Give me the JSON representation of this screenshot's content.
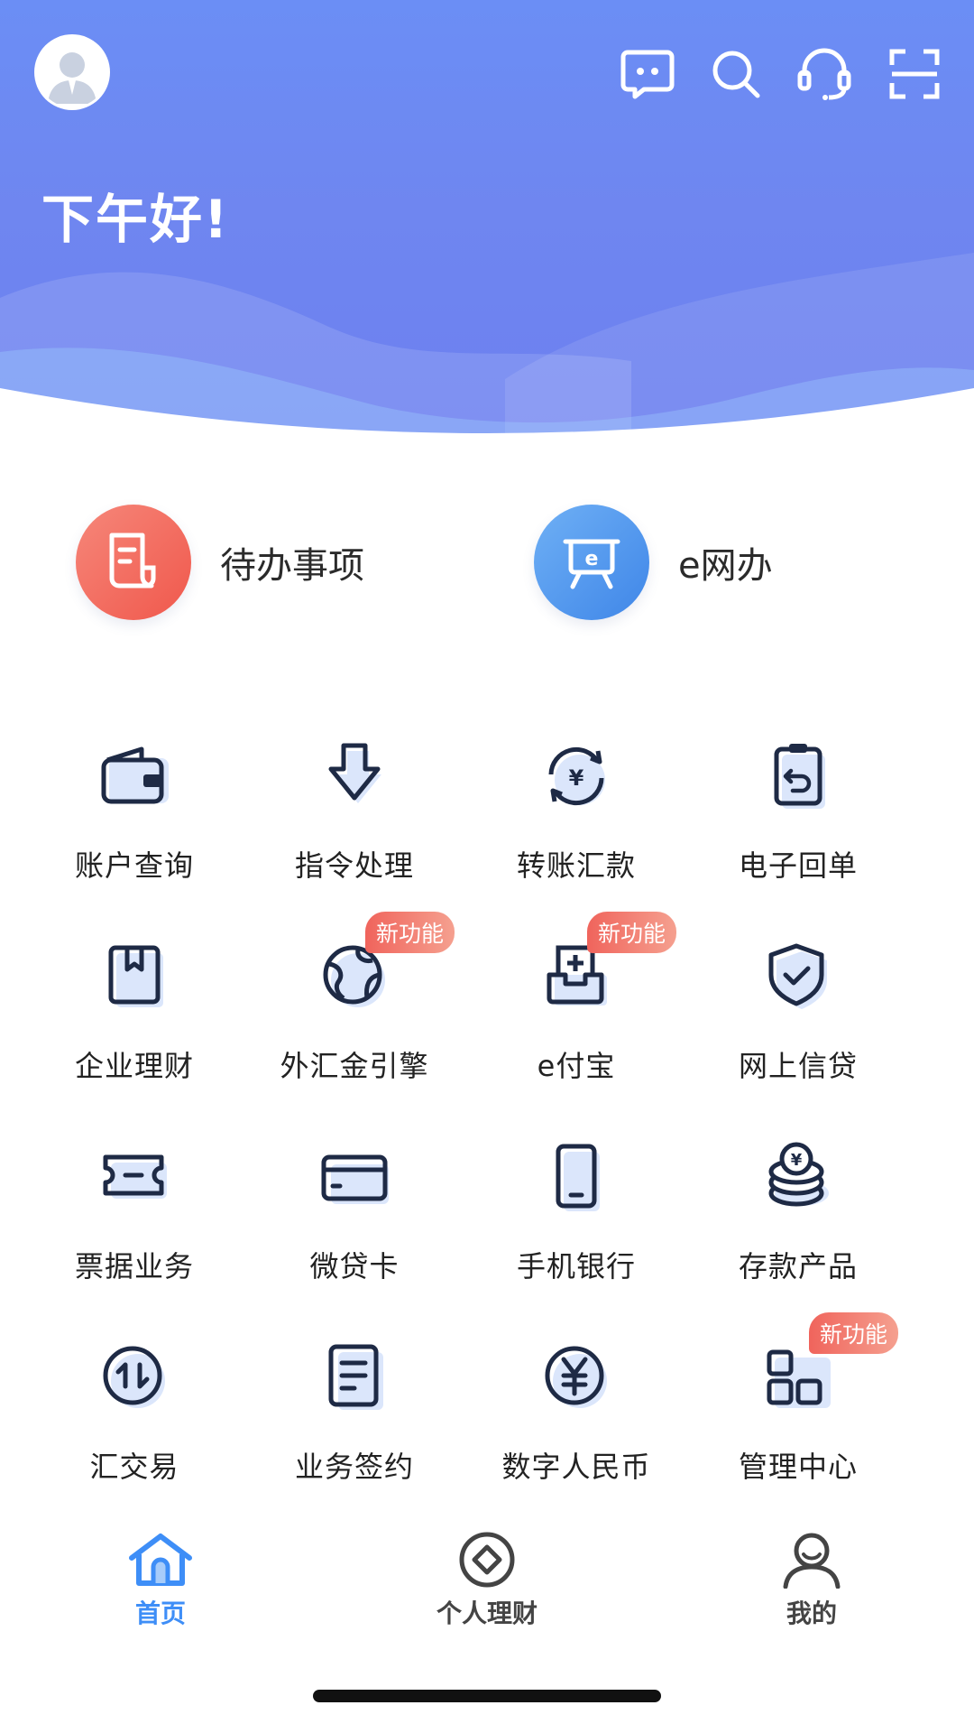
{
  "header": {
    "greeting": "下午好!",
    "icons": [
      "chat-icon",
      "search-icon",
      "customer-service-icon",
      "scan-icon"
    ],
    "gradient": [
      "#6b8ef5",
      "#6c7ff0"
    ]
  },
  "quick_actions": [
    {
      "label": "待办事项",
      "icon": "document-icon",
      "color": "#f26b5e"
    },
    {
      "label": "e网办",
      "icon": "e-board-icon",
      "color": "#4f95ee"
    }
  ],
  "services": [
    {
      "label": "账户查询",
      "icon": "wallet-icon"
    },
    {
      "label": "指令处理",
      "icon": "down-arrow-icon"
    },
    {
      "label": "转账汇款",
      "icon": "yuan-exchange-icon"
    },
    {
      "label": "电子回单",
      "icon": "clipboard-return-icon"
    },
    {
      "label": "企业理财",
      "icon": "bookmark-book-icon"
    },
    {
      "label": "外汇金引擎",
      "icon": "globe-icon",
      "badge": "新功能"
    },
    {
      "label": "e付宝",
      "icon": "inbox-icon",
      "badge": "新功能"
    },
    {
      "label": "网上信贷",
      "icon": "shield-check-icon"
    },
    {
      "label": "票据业务",
      "icon": "ticket-icon"
    },
    {
      "label": "微贷卡",
      "icon": "card-icon"
    },
    {
      "label": "手机银行",
      "icon": "phone-icon"
    },
    {
      "label": "存款产品",
      "icon": "coin-stack-icon"
    },
    {
      "label": "汇交易",
      "icon": "swap-arrows-icon"
    },
    {
      "label": "业务签约",
      "icon": "document-lines-icon"
    },
    {
      "label": "数字人民币",
      "icon": "digital-yuan-icon"
    },
    {
      "label": "管理中心",
      "icon": "blocks-icon",
      "badge": "新功能"
    }
  ],
  "tabbar": {
    "items": [
      {
        "label": "首页",
        "icon": "home-icon",
        "active": true
      },
      {
        "label": "个人理财",
        "icon": "diamond-circle-icon",
        "active": false
      },
      {
        "label": "我的",
        "icon": "person-icon",
        "active": false
      }
    ],
    "active_color": "#3e8ef7"
  }
}
